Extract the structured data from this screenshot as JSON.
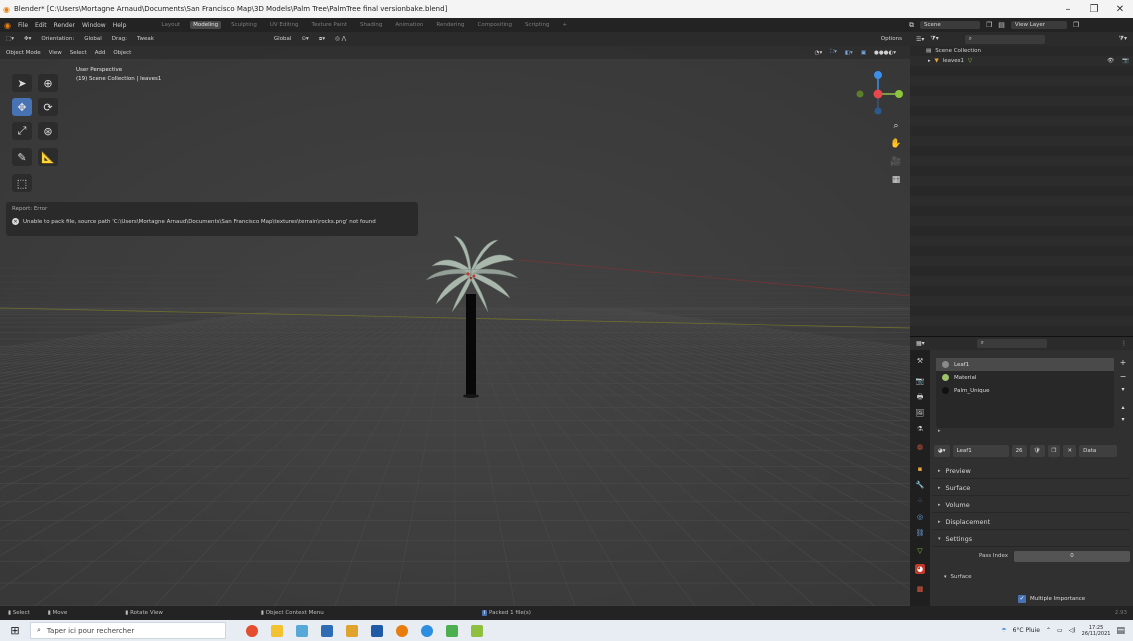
{
  "window": {
    "title": "Blender* [C:\\Users\\Mortagne Arnaud\\Documents\\San Francisco Map\\3D Models\\Palm Tree\\PalmTree final versionbake.blend]",
    "minimize": "–",
    "maximize": "❐",
    "close": "✕"
  },
  "menu": {
    "items": [
      "File",
      "Edit",
      "Render",
      "Window",
      "Help"
    ],
    "workspaces": [
      "Layout",
      "Modeling",
      "Sculpting",
      "UV Editing",
      "Texture Paint",
      "Shading",
      "Animation",
      "Rendering",
      "Compositing",
      "Scripting",
      "+"
    ],
    "active_workspace": "Modeling",
    "scene": "Scene",
    "view_layer": "View Layer"
  },
  "tool_header": {
    "orientation_label": "Orientation:",
    "orientation_value": "Global",
    "drag_label": "Drag:",
    "drag_value": "Tweak",
    "transform": "Global",
    "options": "Options"
  },
  "viewport_header": {
    "mode": "Object Mode",
    "view": "View",
    "select": "Select",
    "add": "Add",
    "object": "Object"
  },
  "overlay": {
    "perspective": "User Perspective",
    "collection": "(19) Scene Collection | leaves1"
  },
  "report": {
    "title": "Report: Error",
    "message": "Unable to pack file, source path 'C:\\Users\\Mortagne Arnaud\\Documents\\San Francisco Map\\textures\\terrain\\rocks.png' not found"
  },
  "statusbar": {
    "select": "Select",
    "move": "Move",
    "rotate": "Rotate View",
    "context": "Object Context Menu",
    "packed": "Packed 1 file(s)",
    "version": "2.93"
  },
  "taskbar": {
    "search_placeholder": "Taper ici pour rechercher",
    "weather": "6°C Pluie",
    "time": "17:25",
    "date": "26/11/2021"
  },
  "outliner": {
    "root": "Scene Collection",
    "items": [
      "leaves1"
    ]
  },
  "properties": {
    "slots": [
      {
        "name": "Leaf1",
        "color": "#8a8a8a"
      },
      {
        "name": "Material",
        "color": "#9fc36a"
      },
      {
        "name": "Palm_Unique",
        "color": "#111111"
      }
    ],
    "material_name": "Leaf1",
    "user_count": "26",
    "link": "Data",
    "panels": [
      "Preview",
      "Surface",
      "Volume",
      "Displacement",
      "Settings"
    ],
    "pass_index_label": "Pass Index",
    "pass_index_value": "0",
    "surface_sub": "Surface",
    "multiple_importance": "Multiple Importance"
  },
  "colors": {
    "accent": "#4772b3",
    "x_axis": "#e8484a",
    "y_axis": "#8cc63f",
    "z_axis": "#3c8ee8"
  }
}
